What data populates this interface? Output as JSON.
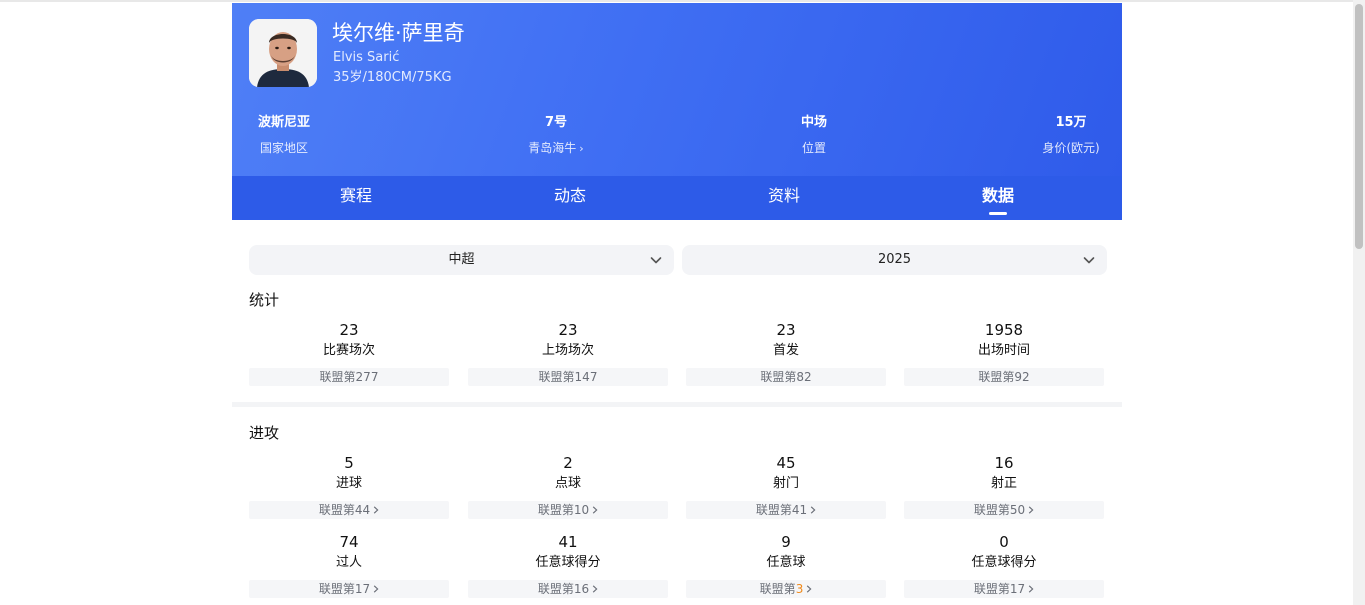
{
  "player": {
    "name_cn": "埃尔维·萨里奇",
    "name_en": "Elvis Sarić",
    "bio": "35岁/180CM/75KG"
  },
  "info": [
    {
      "value": "波斯尼亚",
      "label": "国家地区",
      "link": false
    },
    {
      "value": "7号",
      "label": "青岛海牛",
      "link": true
    },
    {
      "value": "中场",
      "label": "位置",
      "link": false
    },
    {
      "value": "15万",
      "label": "身价(欧元)",
      "link": false
    }
  ],
  "tabs": [
    {
      "label": "赛程",
      "active": false
    },
    {
      "label": "动态",
      "active": false
    },
    {
      "label": "资料",
      "active": false
    },
    {
      "label": "数据",
      "active": true
    }
  ],
  "filters": {
    "league": "中超",
    "season": "2025"
  },
  "stats": {
    "title": "统计",
    "items": [
      {
        "value": "23",
        "label": "比赛场次",
        "rank": "联盟第277"
      },
      {
        "value": "23",
        "label": "上场场次",
        "rank": "联盟第147"
      },
      {
        "value": "23",
        "label": "首发",
        "rank": "联盟第82"
      },
      {
        "value": "1958",
        "label": "出场时间",
        "rank": "联盟第92"
      }
    ]
  },
  "attack": {
    "title": "进攻",
    "items": [
      {
        "value": "5",
        "label": "进球",
        "rank_prefix": "联盟第",
        "rank_num": "44"
      },
      {
        "value": "2",
        "label": "点球",
        "rank_prefix": "联盟第",
        "rank_num": "10"
      },
      {
        "value": "45",
        "label": "射门",
        "rank_prefix": "联盟第",
        "rank_num": "41"
      },
      {
        "value": "16",
        "label": "射正",
        "rank_prefix": "联盟第",
        "rank_num": "50"
      },
      {
        "value": "74",
        "label": "过人",
        "rank_prefix": "联盟第",
        "rank_num": "17"
      },
      {
        "value": "41",
        "label": "任意球得分",
        "rank_prefix": "联盟第",
        "rank_num": "16"
      },
      {
        "value": "9",
        "label": "任意球",
        "rank_prefix": "联盟第",
        "rank_num": "3",
        "highlight": true
      },
      {
        "value": "0",
        "label": "任意球得分",
        "rank_prefix": "联盟第",
        "rank_num": "17"
      }
    ]
  },
  "colors": {
    "hero_start": "#4f7ff6",
    "hero_end": "#2f5bea",
    "tab_bar": "#2d5be8",
    "rank_highlight": "#f08a1c"
  },
  "icons": {
    "select_arrow": "chevron-down-icon",
    "rank_link": "chevron-right-icon"
  }
}
